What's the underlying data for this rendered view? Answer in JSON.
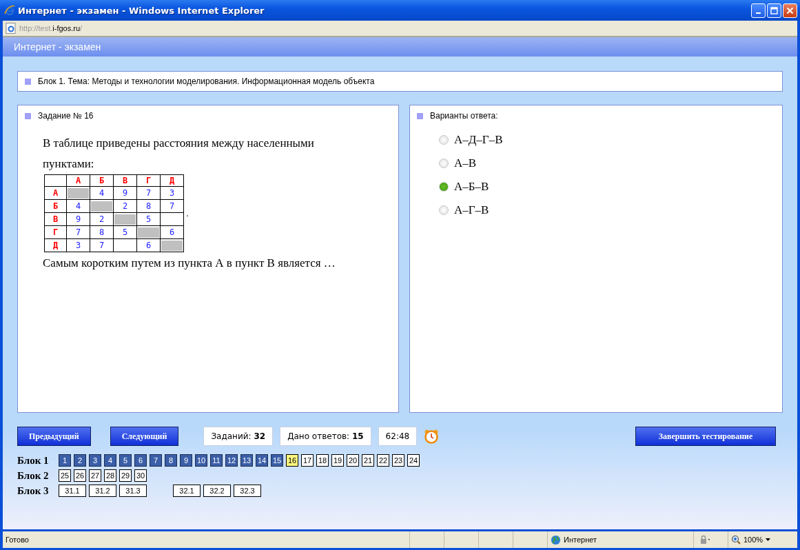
{
  "window": {
    "title": "Интернет - экзамен - Windows Internet Explorer"
  },
  "address": {
    "prefix": "http://test.",
    "host": "i-fgos.ru",
    "suffix": "/"
  },
  "page_header": "Интернет - экзамен",
  "topic": "Блок 1. Тема: Методы и технологии моделирования. Информационная модель объекта",
  "task": {
    "heading": "Задание № 16",
    "intro": "В таблице приведены расстояния между населенными пунктами:",
    "table": {
      "columns": [
        "А",
        "Б",
        "В",
        "Г",
        "Д"
      ],
      "trailing": ".",
      "rows": [
        {
          "label": "А",
          "cells": [
            {
              "kind": "shaded"
            },
            {
              "kind": "value",
              "text": "4"
            },
            {
              "kind": "value",
              "text": "9"
            },
            {
              "kind": "value",
              "text": "7"
            },
            {
              "kind": "value",
              "text": "3"
            }
          ]
        },
        {
          "label": "Б",
          "cells": [
            {
              "kind": "value",
              "text": "4"
            },
            {
              "kind": "shaded"
            },
            {
              "kind": "value",
              "text": "2"
            },
            {
              "kind": "value",
              "text": "8"
            },
            {
              "kind": "value",
              "text": "7"
            }
          ]
        },
        {
          "label": "В",
          "cells": [
            {
              "kind": "value",
              "text": "9"
            },
            {
              "kind": "value",
              "text": "2"
            },
            {
              "kind": "shaded"
            },
            {
              "kind": "value",
              "text": "5"
            },
            {
              "kind": "empty"
            }
          ]
        },
        {
          "label": "Г",
          "cells": [
            {
              "kind": "value",
              "text": "7"
            },
            {
              "kind": "value",
              "text": "8"
            },
            {
              "kind": "value",
              "text": "5"
            },
            {
              "kind": "shaded"
            },
            {
              "kind": "value",
              "text": "6"
            }
          ]
        },
        {
          "label": "Д",
          "cells": [
            {
              "kind": "value",
              "text": "3"
            },
            {
              "kind": "value",
              "text": "7"
            },
            {
              "kind": "empty"
            },
            {
              "kind": "value",
              "text": "6"
            },
            {
              "kind": "shaded"
            }
          ]
        }
      ]
    },
    "question": "Самым коротким путем из пункта А в пункт В является …"
  },
  "answers": {
    "heading": "Варианты ответа:",
    "options": [
      {
        "label": "А–Д–Г–В",
        "selected": false
      },
      {
        "label": "А–В",
        "selected": false
      },
      {
        "label": "А–Б–В",
        "selected": true
      },
      {
        "label": "А–Г–В",
        "selected": false
      }
    ]
  },
  "controls": {
    "prev": "Предыдущий",
    "next": "Следующий",
    "total": "Заданий: **32**",
    "answered": "Дано ответов: **15**",
    "timer": "62:48",
    "finish": "Завершить тестирование"
  },
  "blocks": [
    {
      "label": "Блок 1",
      "groups": [
        [
          {
            "label": "1",
            "answered": true,
            "selected": false
          },
          {
            "label": "2",
            "answered": true,
            "selected": false
          },
          {
            "label": "3",
            "answered": true,
            "selected": false
          },
          {
            "label": "4",
            "answered": true,
            "selected": false
          },
          {
            "label": "5",
            "answered": true,
            "selected": false
          },
          {
            "label": "6",
            "answered": true,
            "selected": false
          },
          {
            "label": "7",
            "answered": true,
            "selected": false
          },
          {
            "label": "8",
            "answered": true,
            "selected": false
          },
          {
            "label": "9",
            "answered": true,
            "selected": false
          },
          {
            "label": "10",
            "answered": true,
            "selected": false
          },
          {
            "label": "11",
            "answered": true,
            "selected": false
          },
          {
            "label": "12",
            "answered": true,
            "selected": false
          },
          {
            "label": "13",
            "answered": true,
            "selected": false
          },
          {
            "label": "14",
            "answered": true,
            "selected": false
          },
          {
            "label": "15",
            "answered": true,
            "selected": false
          },
          {
            "label": "16",
            "answered": false,
            "selected": true
          },
          {
            "label": "17",
            "answered": false,
            "selected": false
          },
          {
            "label": "18",
            "answered": false,
            "selected": false
          },
          {
            "label": "19",
            "answered": false,
            "selected": false
          },
          {
            "label": "20",
            "answered": false,
            "selected": false
          },
          {
            "label": "21",
            "answered": false,
            "selected": false
          },
          {
            "label": "22",
            "answered": false,
            "selected": false
          },
          {
            "label": "23",
            "answered": false,
            "selected": false
          },
          {
            "label": "24",
            "answered": false,
            "selected": false
          }
        ]
      ]
    },
    {
      "label": "Блок 2",
      "groups": [
        [
          {
            "label": "25",
            "answered": false,
            "selected": false
          },
          {
            "label": "26",
            "answered": false,
            "selected": false
          },
          {
            "label": "27",
            "answered": false,
            "selected": false
          },
          {
            "label": "28",
            "answered": false,
            "selected": false
          },
          {
            "label": "29",
            "answered": false,
            "selected": false
          },
          {
            "label": "30",
            "answered": false,
            "selected": false
          }
        ]
      ]
    },
    {
      "label": "Блок 3",
      "groups": [
        [
          {
            "label": "31.1",
            "answered": false,
            "selected": false
          },
          {
            "label": "31.2",
            "answered": false,
            "selected": false
          },
          {
            "label": "31.3",
            "answered": false,
            "selected": false
          }
        ],
        [
          {
            "label": "32.1",
            "answered": false,
            "selected": false
          },
          {
            "label": "32.2",
            "answered": false,
            "selected": false
          },
          {
            "label": "32.3",
            "answered": false,
            "selected": false
          }
        ]
      ]
    }
  ],
  "status_bar": {
    "text": "Готово",
    "zone": "Интернет",
    "zoom": "100%"
  }
}
